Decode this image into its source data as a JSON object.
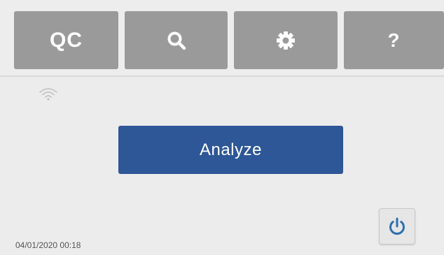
{
  "toolbar": {
    "qc_label": "QC",
    "search_icon": "search-icon",
    "settings_icon": "gear-icon",
    "help_label": "?"
  },
  "status": {
    "wifi_icon": "wifi-icon",
    "datetime": "04/01/2020 00:18"
  },
  "main": {
    "analyze_label": "Analyze"
  },
  "power": {
    "icon": "power-icon"
  },
  "colors": {
    "toolbar_button": "#9a9a9a",
    "primary_button": "#2e5797",
    "background": "#ececec",
    "power_icon": "#2e6fb0"
  }
}
